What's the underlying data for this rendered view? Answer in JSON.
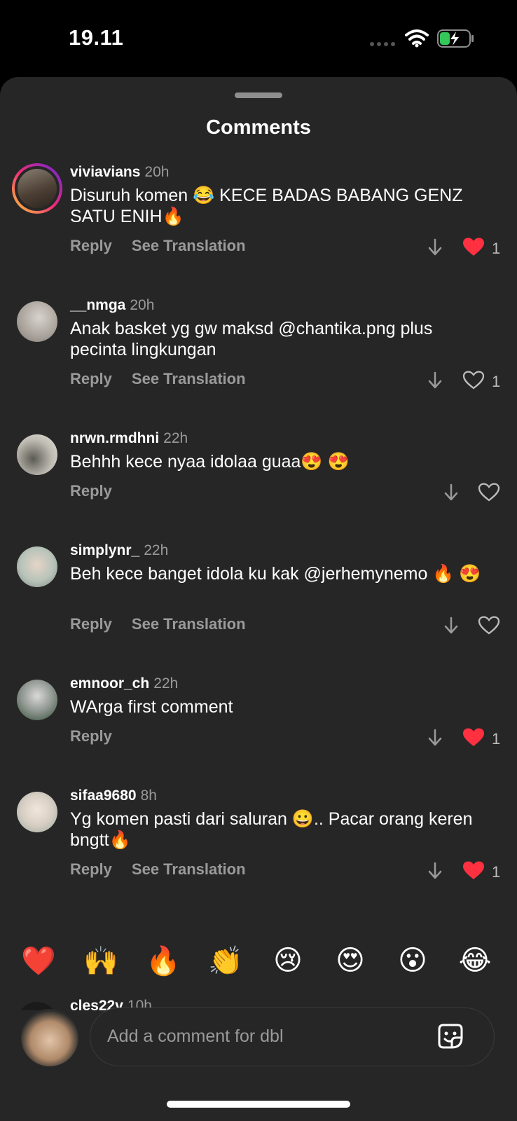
{
  "status": {
    "time": "19.11"
  },
  "sheet": {
    "title": "Comments"
  },
  "comments": [
    {
      "username": "viviavians",
      "time": "20h",
      "text": "Disuruh komen 😂 KECE BADAS BABANG GENZ SATU ENIH🔥",
      "reply": "Reply",
      "translate": "See Translation",
      "liked": true,
      "likes": "1"
    },
    {
      "username": "__nmga",
      "time": "20h",
      "text": "Anak basket yg gw maksd @chantika.png plus pecinta lingkungan",
      "reply": "Reply",
      "translate": "See Translation",
      "liked": false,
      "likes": "1"
    },
    {
      "username": "nrwn.rmdhni",
      "time": "22h",
      "text": "Behhh kece nyaa idolaa guaa😍 😍",
      "reply": "Reply",
      "translate": "",
      "liked": false,
      "likes": ""
    },
    {
      "username": "simplynr_",
      "time": "22h",
      "text": "Beh kece banget idola ku kak @jerhemynemo 🔥 😍",
      "reply": "Reply",
      "translate": "See Translation",
      "liked": false,
      "likes": ""
    },
    {
      "username": "emnoor_ch",
      "time": "22h",
      "text": "WArga first comment",
      "reply": "Reply",
      "translate": "",
      "liked": true,
      "likes": "1"
    },
    {
      "username": "sifaa9680",
      "time": "8h",
      "text": "Yg komen pasti dari saluran 😀.. Pacar orang keren bngtt🔥",
      "reply": "Reply",
      "translate": "See Translation",
      "liked": true,
      "likes": "1"
    },
    {
      "username": "cles22v",
      "time": "10h",
      "text": "",
      "reply": "",
      "translate": "",
      "liked": false,
      "likes": ""
    }
  ],
  "quick_reactions": [
    "❤️",
    "🙌",
    "🔥",
    "👏",
    "😢",
    "😍",
    "😮",
    "😂"
  ],
  "composer": {
    "placeholder": "Add a comment for dbl"
  },
  "colors": {
    "background": "#000000",
    "sheet": "#262626",
    "like": "#ff3040",
    "muted": "#9a9a9a"
  },
  "icons": [
    "wifi-icon",
    "battery-charging-icon",
    "down-arrow-icon",
    "heart-icon",
    "heart-filled-icon",
    "sticker-icon"
  ]
}
